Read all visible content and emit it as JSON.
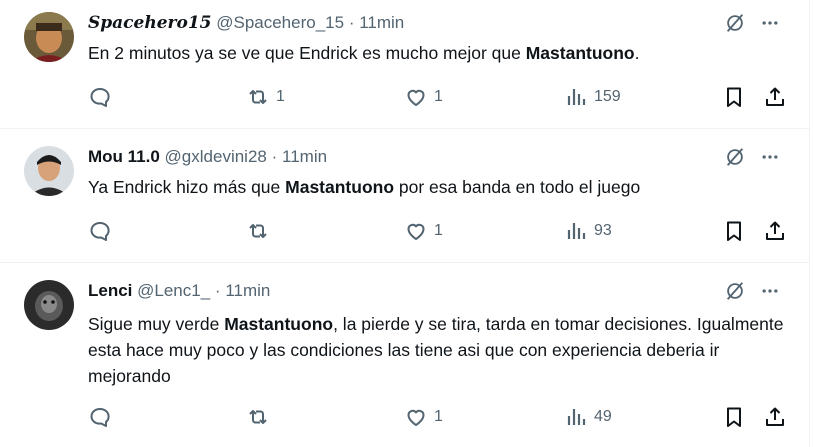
{
  "tweets": [
    {
      "name": "Spacehero15",
      "handle": "@Spacehero_15",
      "separator": "·",
      "time": "11min",
      "text_before": "En 2 minutos ya se ve que Endrick es mucho mejor que ",
      "text_bold": "Mastantuono",
      "text_after": ".",
      "reply_count": "",
      "retweet_count": "1",
      "like_count": "1",
      "view_count": "159"
    },
    {
      "name": "Mou 11.0",
      "handle": "@gxldevini28",
      "separator": "·",
      "time": "11min",
      "text_before": "Ya Endrick hizo más que ",
      "text_bold": "Mastantuono",
      "text_after": " por esa banda en todo el juego",
      "reply_count": "",
      "retweet_count": "",
      "like_count": "1",
      "view_count": "93"
    },
    {
      "name": "Lenci",
      "handle": "@Lenc1_",
      "separator": "·",
      "time": "11min",
      "text_before": "Sigue muy verde ",
      "text_bold": "Mastantuono",
      "text_after": ", la pierde y se tira, tarda en tomar decisiones. Igualmente esta hace muy poco y las condiciones las tiene asi que con experiencia deberia ir mejorando",
      "reply_count": "",
      "retweet_count": "",
      "like_count": "1",
      "view_count": "49"
    }
  ],
  "icons": {
    "grok": "grok-slash-icon",
    "more": "more-icon",
    "reply": "reply-icon",
    "retweet": "retweet-icon",
    "like": "like-icon",
    "views": "views-icon",
    "bookmark": "bookmark-icon",
    "share": "share-icon"
  },
  "colors": {
    "text": "#0f1419",
    "secondary": "#536471",
    "divider": "#eff3f4"
  }
}
